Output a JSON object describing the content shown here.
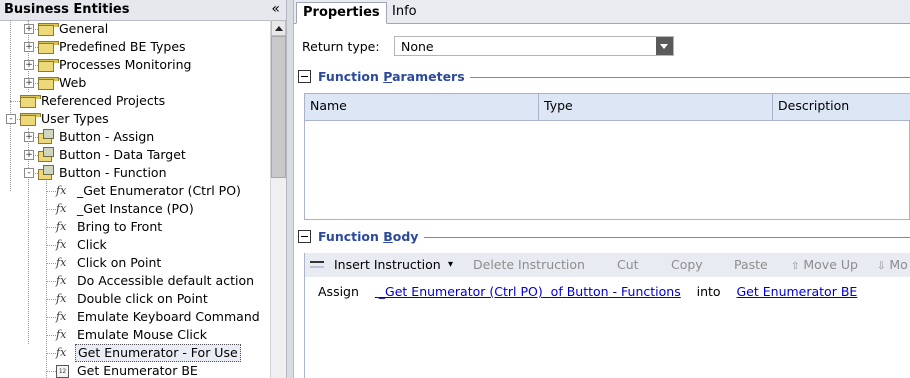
{
  "left_panel": {
    "title": "Business Entities",
    "collapse_glyph": "«",
    "tree": [
      {
        "label": "General",
        "depth": 1,
        "icon": "folder-icon",
        "expander": "+"
      },
      {
        "label": "Predefined BE Types",
        "depth": 1,
        "icon": "folder-icon",
        "expander": "+"
      },
      {
        "label": "Processes Monitoring",
        "depth": 1,
        "icon": "folder-icon",
        "expander": "+"
      },
      {
        "label": "Web",
        "depth": 1,
        "icon": "folder-icon",
        "expander": "+"
      },
      {
        "label": "Referenced Projects",
        "depth": 0,
        "icon": "folder-icon",
        "expander": ""
      },
      {
        "label": "User Types",
        "depth": 0,
        "icon": "folder-open-icon",
        "expander": "-"
      },
      {
        "label": "Button - Assign",
        "depth": 1,
        "icon": "user-type-icon",
        "expander": "+"
      },
      {
        "label": "Button - Data Target",
        "depth": 1,
        "icon": "user-type-icon",
        "expander": "+"
      },
      {
        "label": "Button - Function",
        "depth": 1,
        "icon": "user-type-icon",
        "expander": "-"
      },
      {
        "label": "_Get Enumerator (Ctrl PO)",
        "depth": 2,
        "icon": "function-icon",
        "expander": ""
      },
      {
        "label": "_Get Instance (PO)",
        "depth": 2,
        "icon": "function-icon",
        "expander": ""
      },
      {
        "label": "Bring to Front",
        "depth": 2,
        "icon": "function-icon",
        "expander": ""
      },
      {
        "label": "Click",
        "depth": 2,
        "icon": "function-icon",
        "expander": ""
      },
      {
        "label": "Click on Point",
        "depth": 2,
        "icon": "function-icon",
        "expander": ""
      },
      {
        "label": "Do Accessible default action",
        "depth": 2,
        "icon": "function-icon",
        "expander": ""
      },
      {
        "label": "Double click on Point",
        "depth": 2,
        "icon": "function-icon",
        "expander": ""
      },
      {
        "label": "Emulate Keyboard Command",
        "depth": 2,
        "icon": "function-icon",
        "expander": ""
      },
      {
        "label": "Emulate Mouse Click",
        "depth": 2,
        "icon": "function-icon",
        "expander": ""
      },
      {
        "label": "Get Enumerator - For Use",
        "depth": 2,
        "icon": "function-icon",
        "expander": "",
        "selected": true
      },
      {
        "label": "Get Enumerator BE",
        "depth": 2,
        "icon": "business-entity-icon",
        "expander": "",
        "icon_text": "12"
      }
    ]
  },
  "right_panel": {
    "tabs": [
      {
        "label": "Properties",
        "active": true
      },
      {
        "label": "Info",
        "active": false
      }
    ],
    "return_type": {
      "label": "Return type:",
      "value": "None"
    },
    "function_parameters": {
      "title_before": "Function ",
      "title_underlined": "P",
      "title_after": "arameters",
      "columns": [
        "Name",
        "Type",
        "Description"
      ]
    },
    "function_body": {
      "title_before": "Function ",
      "title_underlined": "B",
      "title_after": "ody",
      "toolbar": {
        "insert": "Insert Instruction",
        "insert_caret": "▾",
        "delete": "Delete Instruction",
        "cut": "Cut",
        "copy": "Copy",
        "paste": "Paste",
        "move_up": "Move Up",
        "move_down": "Mo"
      },
      "instruction": {
        "keyword": "Assign",
        "function_link": "_Get Enumerator (Ctrl PO)",
        "of_text": "of",
        "owner_link": "Button - Functions",
        "into_text": "into",
        "target_link": "Get Enumerator BE"
      }
    }
  },
  "colors": {
    "section_title": "#2b4a9c",
    "link": "#0000cc",
    "header_bg": "#dde6f5",
    "toolbar_bg": "#e8ebf2",
    "disabled_text": "#8d8d8d"
  }
}
